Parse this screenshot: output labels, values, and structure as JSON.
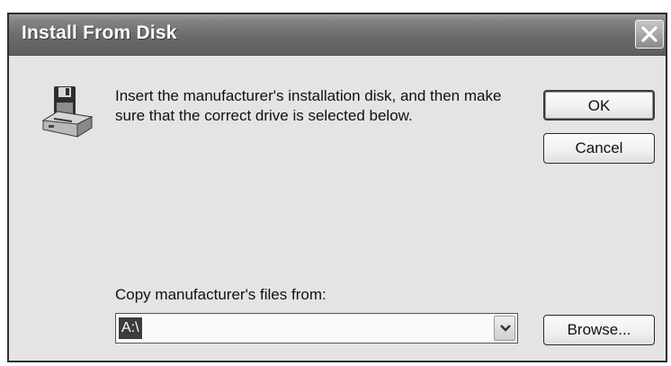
{
  "window": {
    "title": "Install From Disk"
  },
  "titlebar": {
    "close_icon": "close-icon"
  },
  "message": {
    "text": "Insert the manufacturer's installation disk, and then make sure that the correct drive is selected below.",
    "icon": "floppy-disk-drive-icon"
  },
  "buttons": {
    "ok_label": "OK",
    "cancel_label": "Cancel",
    "browse_label": "Browse..."
  },
  "copy_from": {
    "label": "Copy manufacturer's files from:",
    "value": "A:\\",
    "dropdown_icon": "chevron-down-icon"
  }
}
